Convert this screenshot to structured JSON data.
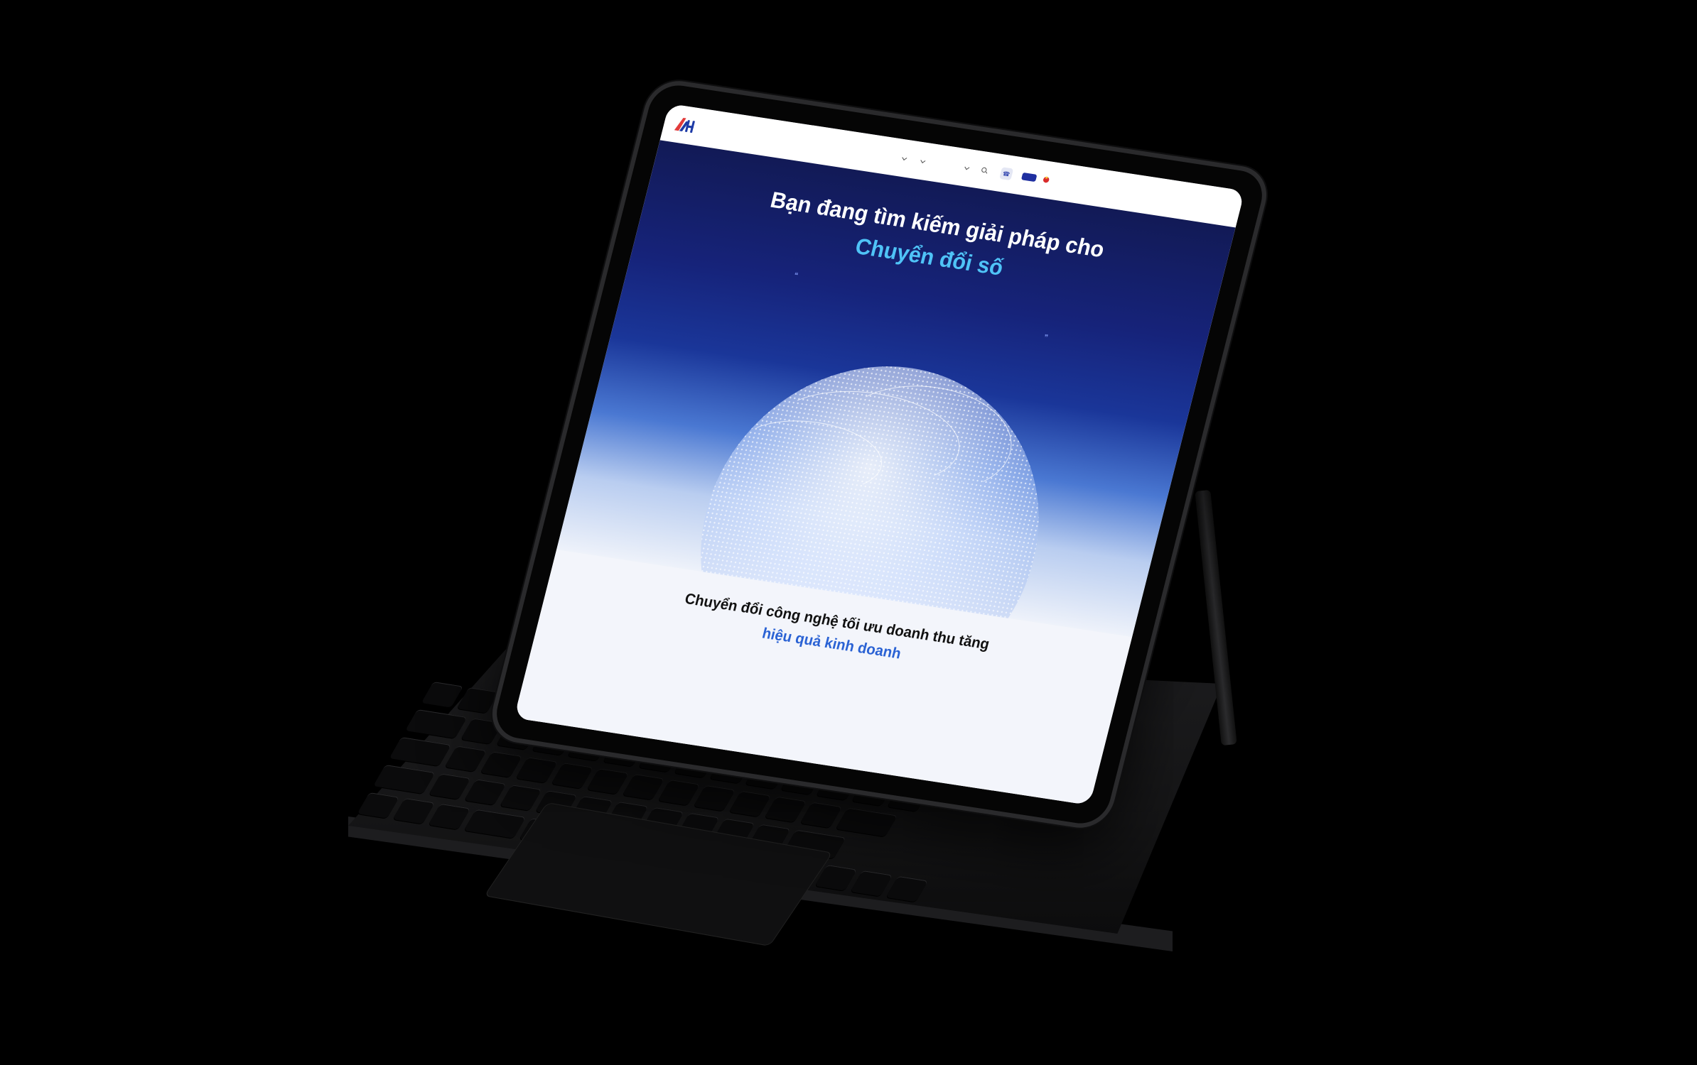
{
  "logo": {
    "line1": "",
    "line2": "",
    "line3": ""
  },
  "nav": {
    "items": [
      "",
      "",
      "",
      "",
      "",
      ""
    ]
  },
  "hotline": {
    "label": "",
    "number": ""
  },
  "header": {
    "contact_label": "",
    "language": ""
  },
  "hero": {
    "title": "Bạn đang tìm kiếm giải pháp cho",
    "highlight": "Chuyển đổi số",
    "description": ""
  },
  "section": {
    "eyebrow": "",
    "title": "Chuyển đổi công nghệ tối ưu doanh thu tăng",
    "highlight": "hiệu quả kinh doanh"
  },
  "colors": {
    "background": "#000000",
    "hero_top": "#121a56",
    "hero_highlight": "#4fc3f7",
    "primary_button": "#1f2fa0",
    "section_highlight": "#2a62d4"
  }
}
